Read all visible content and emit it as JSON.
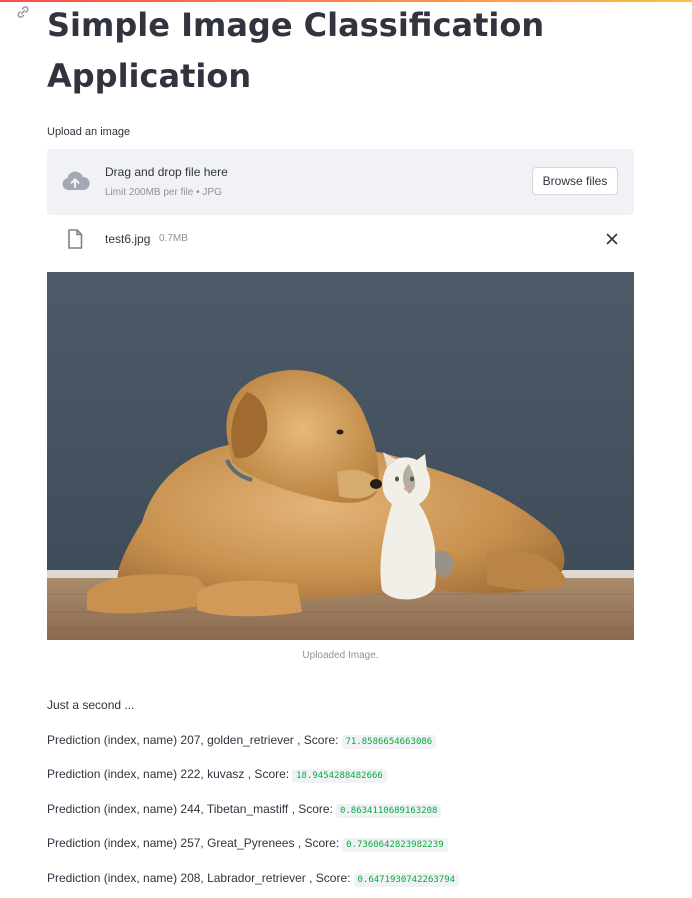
{
  "app": {
    "title": "Simple Image Classification Application"
  },
  "uploader": {
    "label": "Upload an image",
    "drop_text": "Drag and drop file here",
    "limit_text": "Limit 200MB per file • JPG",
    "browse_label": "Browse files"
  },
  "file": {
    "name": "test6.jpg",
    "size": "0.7MB"
  },
  "image": {
    "caption": "Uploaded Image."
  },
  "status": "Just a second ...",
  "predictions": [
    {
      "text": "Prediction (index, name) 207, golden_retriever , Score:",
      "score": "71.8586654663086"
    },
    {
      "text": "Prediction (index, name) 222, kuvasz , Score:",
      "score": "18.9454288482666"
    },
    {
      "text": "Prediction (index, name) 244, Tibetan_mastiff , Score:",
      "score": "0.8634110689163208"
    },
    {
      "text": "Prediction (index, name) 257, Great_Pyrenees , Score:",
      "score": "0.7360642823982239"
    },
    {
      "text": "Prediction (index, name) 208, Labrador_retriever , Score:",
      "score": "0.6471930742263794"
    }
  ],
  "colors": {
    "accent_red": "#ff4b4b",
    "score_green": "#09ab3b",
    "dropzone_bg": "#f0f2f6"
  }
}
